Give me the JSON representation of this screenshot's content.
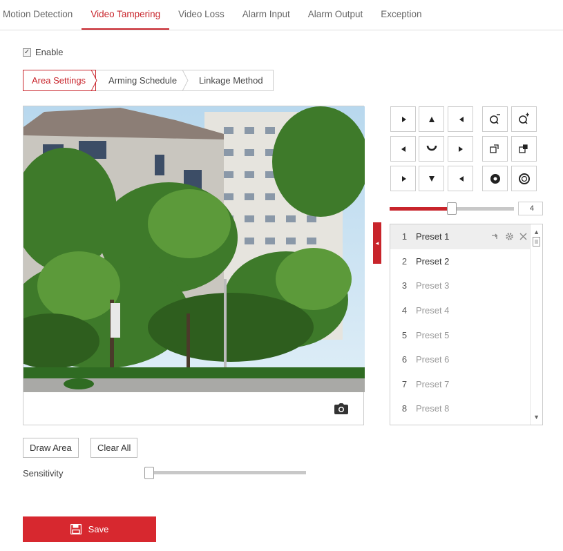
{
  "top_tabs": [
    {
      "label": "Motion Detection"
    },
    {
      "label": "Video Tampering"
    },
    {
      "label": "Video Loss"
    },
    {
      "label": "Alarm Input"
    },
    {
      "label": "Alarm Output"
    },
    {
      "label": "Exception"
    }
  ],
  "active_tab": "Video Tampering",
  "enable": {
    "label": "Enable",
    "checked": true
  },
  "sub_tabs": [
    {
      "label": "Area Settings"
    },
    {
      "label": "Arming Schedule"
    },
    {
      "label": "Linkage Method"
    }
  ],
  "ptz": {
    "icons": [
      "pan-up-left-icon",
      "pan-up-icon",
      "pan-up-right-icon",
      "zoom-out-icon",
      "zoom-in-icon",
      "pan-left-icon",
      "auto-pan-icon",
      "pan-right-icon",
      "focus-near-icon",
      "focus-far-icon",
      "pan-down-left-icon",
      "pan-down-icon",
      "pan-down-right-icon",
      "iris-open-icon",
      "iris-close-icon"
    ],
    "speed_value": "4",
    "speed_fraction": 0.5
  },
  "presets": [
    {
      "num": "1",
      "name": "Preset 1"
    },
    {
      "num": "2",
      "name": "Preset 2"
    },
    {
      "num": "3",
      "name": "Preset 3"
    },
    {
      "num": "4",
      "name": "Preset 4"
    },
    {
      "num": "5",
      "name": "Preset 5"
    },
    {
      "num": "6",
      "name": "Preset 6"
    },
    {
      "num": "7",
      "name": "Preset 7"
    },
    {
      "num": "8",
      "name": "Preset 8"
    }
  ],
  "buttons": {
    "draw_area": "Draw Area",
    "clear_all": "Clear All",
    "save": "Save"
  },
  "sensitivity": {
    "label": "Sensitivity",
    "value_fraction": 0.0
  },
  "colors": {
    "accent": "#c8242b",
    "save_bg": "#d7282f"
  }
}
